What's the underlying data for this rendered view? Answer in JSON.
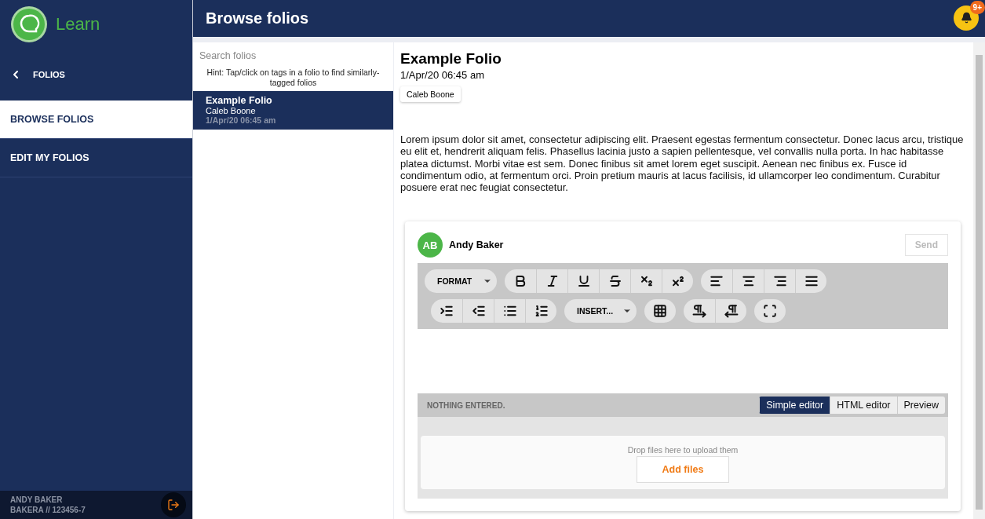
{
  "sidebar": {
    "brand": "Learn",
    "back": "FOLIOS",
    "items": [
      {
        "label": "BROWSE FOLIOS",
        "selected": true
      },
      {
        "label": "EDIT MY FOLIOS",
        "selected": false
      }
    ],
    "user": {
      "name": "ANDY BAKER",
      "id": "BAKERA // 123456-7"
    }
  },
  "header": {
    "title": "Browse folios",
    "badge": "9+"
  },
  "list": {
    "search": {
      "placeholder": "Search folios"
    },
    "hint": "Hint: Tap/click on tags in a folio to find similarly-tagged folios",
    "folios": [
      {
        "title": "Example Folio",
        "author": "Caleb Boone",
        "date": "1/Apr/20 06:45 am",
        "selected": true
      }
    ]
  },
  "detail": {
    "title": "Example Folio",
    "date": "1/Apr/20 06:45 am",
    "tags": [
      "Caleb Boone"
    ],
    "body": "Lorem ipsum dolor sit amet, consectetur adipiscing elit. Praesent egestas fermentum consectetur. Donec lacus arcu, tristique eu elit et, hendrerit aliquam felis. Phasellus lacinia justo a sapien pellentesque, vel convallis nulla porta. In hac habitasse platea dictumst. Morbi vitae est sem. Donec finibus sit amet lorem eget suscipit. Aenean nec finibus ex. Fusce id condimentum odio, at fermentum orci. Proin pretium mauris at lacus facilisis, id ullamcorper leo condimentum. Curabitur posuere erat nec feugiat consectetur."
  },
  "comment": {
    "avatar": "AB",
    "author": "Andy Baker",
    "send": {
      "label": "Send",
      "disabled": true
    },
    "format_menu": "FORMAT",
    "insert_menu": "INSERT...",
    "status": "NOTHING ENTERED.",
    "modes": [
      {
        "label": "Simple editor",
        "selected": true
      },
      {
        "label": "HTML editor",
        "selected": false
      },
      {
        "label": "Preview",
        "selected": false
      }
    ],
    "upload": {
      "hint": "Drop files here to upload them",
      "button": "Add files"
    }
  }
}
